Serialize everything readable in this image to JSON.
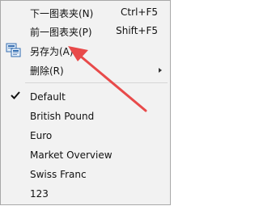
{
  "menu": {
    "items": [
      {
        "label": "下一图表夹(N)",
        "shortcut": "Ctrl+F5"
      },
      {
        "label": "前一图表夹(P)",
        "shortcut": "Shift+F5"
      },
      {
        "label": "另存为(A)...",
        "icon": "save-as-icon"
      },
      {
        "label": "删除(R)",
        "submenu": true
      }
    ],
    "profiles": [
      {
        "label": "Default",
        "checked": true
      },
      {
        "label": "British Pound"
      },
      {
        "label": "Euro"
      },
      {
        "label": "Market Overview"
      },
      {
        "label": "Swiss Franc"
      },
      {
        "label": "123"
      }
    ]
  },
  "annotation": {
    "arrow_color": "#e84a4a"
  }
}
